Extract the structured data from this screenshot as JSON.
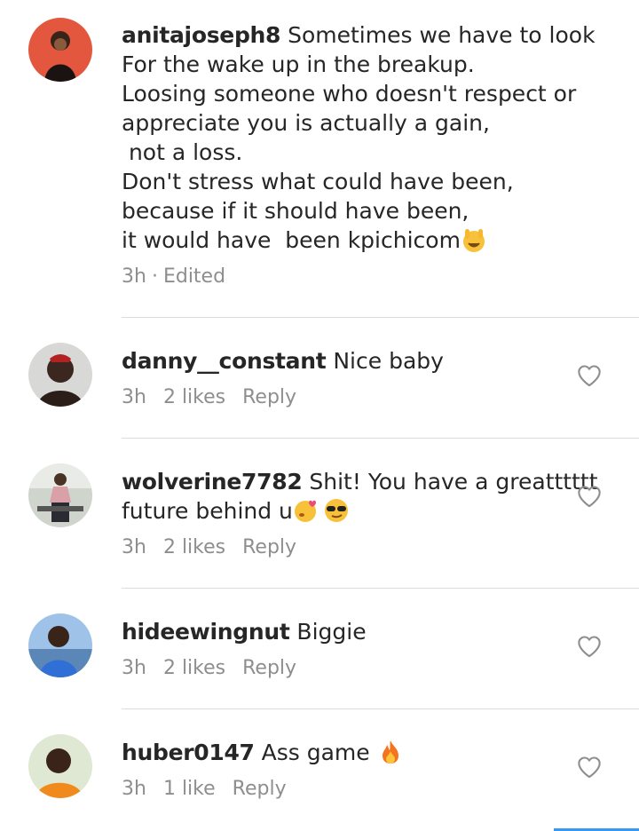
{
  "comments": [
    {
      "username": "anitajoseph8",
      "text": " Sometimes we have to look\nFor the wake up in the breakup.\nLoosing someone who doesn't respect or appreciate you is actually a gain,\n not a loss.\nDon't stress what could have been,\nbecause if it should have been,\nit would have  been kpichicom",
      "emoji": [
        "horns-emoji"
      ],
      "time": "3h",
      "sep": "·",
      "edited": "Edited"
    },
    {
      "username": "danny__constant",
      "text": " Nice baby",
      "time": "3h",
      "likes": "2 likes",
      "reply": "Reply"
    },
    {
      "username": "wolverine7782",
      "text": " Shit! You have a greatttttt  future behind u",
      "emoji": [
        "kiss-emoji",
        "sunglasses-emoji"
      ],
      "time": "3h",
      "likes": "2 likes",
      "reply": "Reply"
    },
    {
      "username": "hideewingnut",
      "text": " Biggie",
      "time": "3h",
      "likes": "2 likes",
      "reply": "Reply"
    },
    {
      "username": "huber0147",
      "text": " Ass game ",
      "emoji": [
        "fire-emoji"
      ],
      "time": "3h",
      "likes": "1 like",
      "reply": "Reply"
    }
  ],
  "icons": {
    "heart": "heart-outline-icon",
    "avatar": "user-avatar"
  },
  "colors": {
    "text": "#262626",
    "meta": "#8e8e8e",
    "divider": "#dbdbdb",
    "accent": "#3897f0"
  }
}
